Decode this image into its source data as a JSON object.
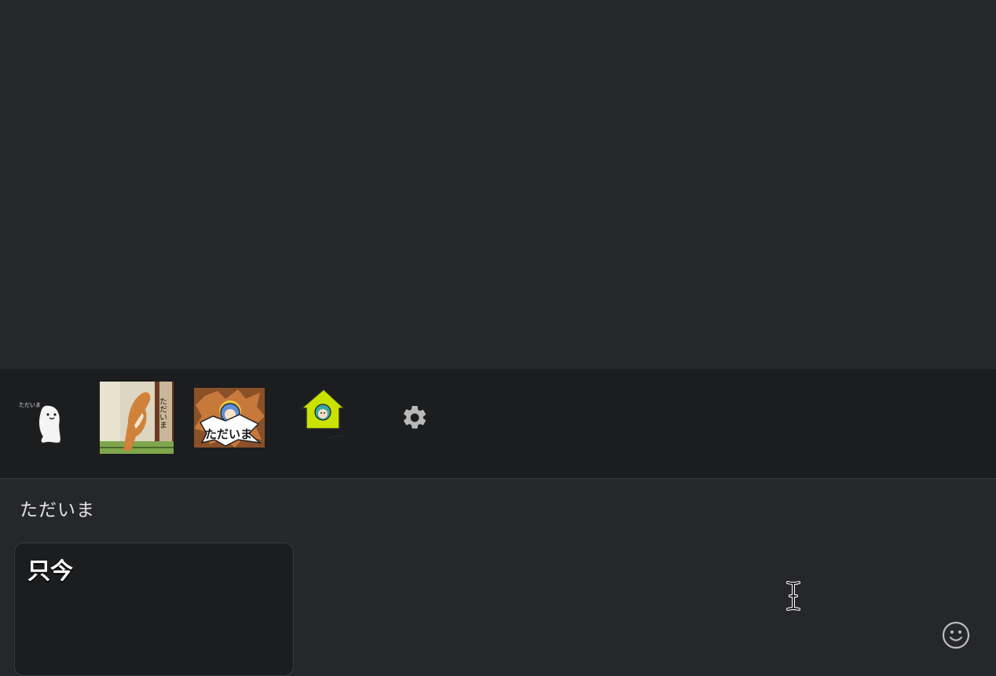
{
  "chat": {},
  "sticker_bar": {
    "stickers": [
      {
        "icon": "white-ghost-sticker-icon",
        "caption": "ただいま"
      },
      {
        "icon": "shiba-dog-door-sticker-icon",
        "caption": "ただいま"
      },
      {
        "icon": "blue-character-burst-sticker-icon",
        "caption": "ただいま"
      },
      {
        "icon": "green-house-sticker-icon"
      }
    ],
    "settings_icon": "gear-icon"
  },
  "input": {
    "value": "ただいま"
  },
  "suggestion": {
    "text": "只今"
  },
  "emoji_icon": "smiley-icon",
  "colors": {
    "background": "#26272b",
    "sticker_bar": "#1c1d1f",
    "text": "#e2e2e2"
  }
}
